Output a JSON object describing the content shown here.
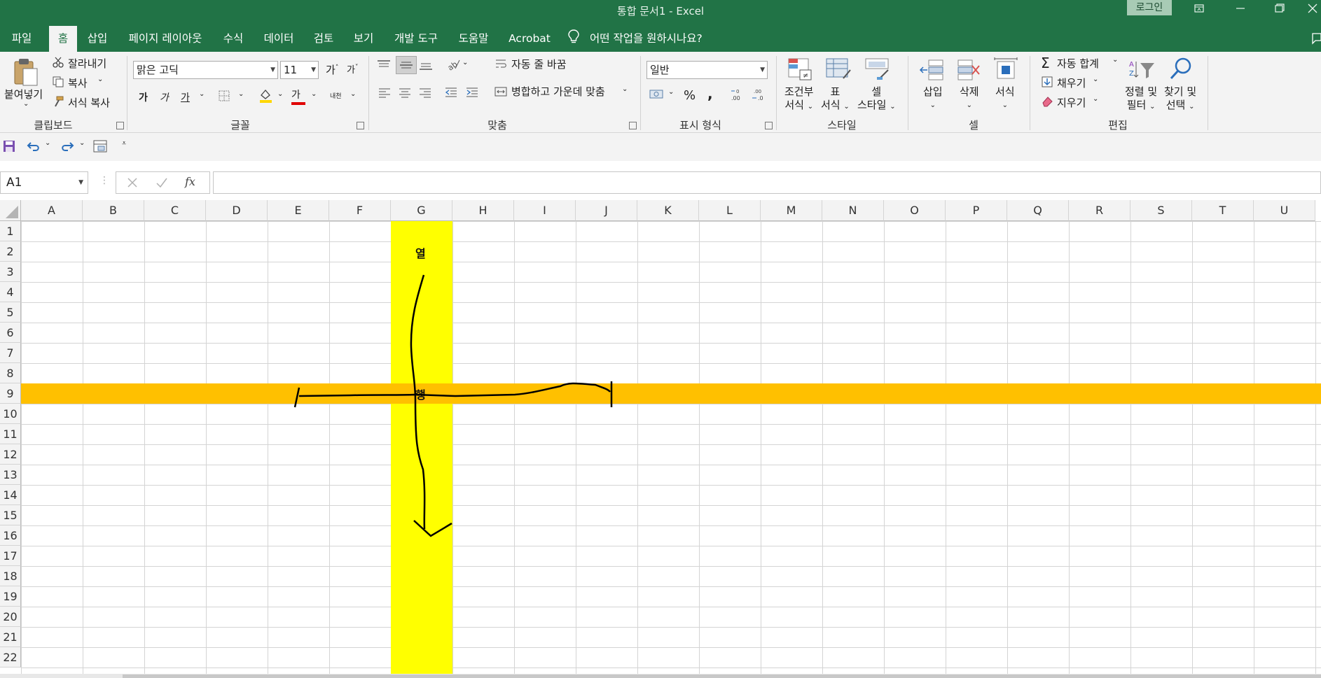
{
  "window": {
    "title": "통합 문서1  -  Excel",
    "login_label": "로그인",
    "accent_color": "#217346"
  },
  "menu": {
    "tabs": [
      {
        "label": "파일",
        "active": false
      },
      {
        "label": "홈",
        "active": true
      },
      {
        "label": "삽입",
        "active": false
      },
      {
        "label": "페이지 레이아웃",
        "active": false
      },
      {
        "label": "수식",
        "active": false
      },
      {
        "label": "데이터",
        "active": false
      },
      {
        "label": "검토",
        "active": false
      },
      {
        "label": "보기",
        "active": false
      },
      {
        "label": "개발 도구",
        "active": false
      },
      {
        "label": "도움말",
        "active": false
      },
      {
        "label": "Acrobat",
        "active": false
      }
    ],
    "tell_me": "어떤 작업을 원하시나요?"
  },
  "ribbon": {
    "clipboard": {
      "group": "클립보드",
      "paste": "붙여넣기",
      "cut": "잘라내기",
      "copy": "복사",
      "format_painter": "서식 복사"
    },
    "font": {
      "group": "글꼴",
      "font_name": "맑은 고딕",
      "font_size": "11",
      "grow": "가",
      "shrink": "가",
      "bold": "가",
      "italic": "가",
      "underline": "가",
      "font_color_glyph": "가",
      "phonetic_glyph": "내천",
      "fill_color": "#ffd700",
      "font_color": "#e00000"
    },
    "alignment": {
      "group": "맞춤",
      "wrap_text": "자동 줄 바꿈",
      "merge_center": "병합하고 가운데 맞춤"
    },
    "number": {
      "group": "표시 형식",
      "format": "일반",
      "percent": "%",
      "comma": ","
    },
    "styles": {
      "group": "스타일",
      "conditional": [
        "조건부",
        "서식"
      ],
      "table": [
        "표",
        "서식"
      ],
      "cell": [
        "셀",
        "스타일"
      ]
    },
    "cells": {
      "group": "셀",
      "insert": "삽입",
      "delete": "삭제",
      "format": "서식"
    },
    "editing": {
      "group": "편집",
      "autosum": "자동 합계",
      "fill": "채우기",
      "clear": "지우기",
      "sort_filter": [
        "정렬 및",
        "필터"
      ],
      "find_select": [
        "찾기 및",
        "선택"
      ]
    }
  },
  "formula_bar": {
    "name_box": "A1",
    "fx": "fx",
    "formula": ""
  },
  "sheet": {
    "columns": [
      "A",
      "B",
      "C",
      "D",
      "E",
      "F",
      "G",
      "H",
      "I",
      "J",
      "K",
      "L",
      "M",
      "N",
      "O",
      "P",
      "Q",
      "R",
      "S",
      "T",
      "U"
    ],
    "rows": [
      "1",
      "2",
      "3",
      "4",
      "5",
      "6",
      "7",
      "8",
      "9",
      "10",
      "11",
      "12",
      "13",
      "14",
      "15",
      "16",
      "17",
      "18",
      "19",
      "20",
      "21",
      "22"
    ],
    "highlight_column": "G",
    "highlight_row": "9",
    "column_color": "#ffff00",
    "row_color": "#ffc000",
    "column_label": "열",
    "row_label": "행"
  }
}
